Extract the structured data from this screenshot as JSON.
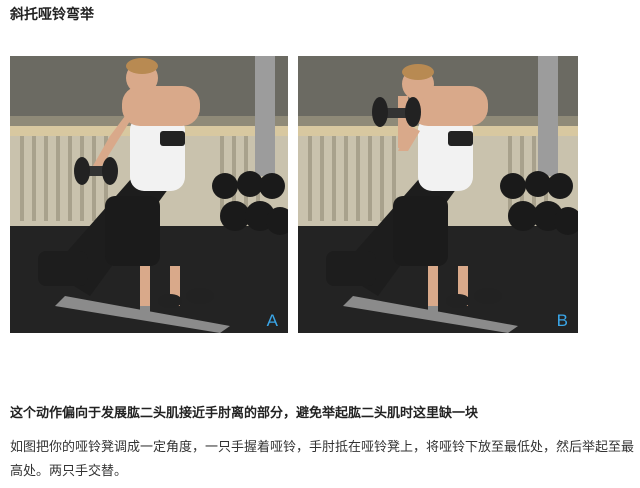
{
  "title": "斜托哑铃弯举",
  "photos": [
    {
      "label": "A"
    },
    {
      "label": "B"
    }
  ],
  "subheading": "这个动作偏向于发展肱二头肌接近手肘离的部分，避免举起肱二头肌时这里缺一块",
  "description": "如图把你的哑铃凳调成一定角度，一只手握着哑铃，手肘抵在哑铃凳上，将哑铃下放至最低处，然后举起至最高处。两只手交替。",
  "colors": {
    "label": "#3aa6e8",
    "background": "#ffffff"
  }
}
